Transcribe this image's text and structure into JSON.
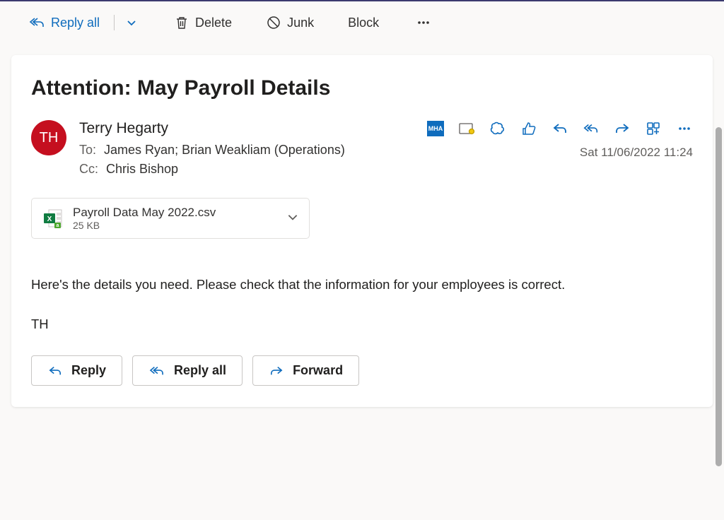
{
  "toolbar": {
    "reply_all": "Reply all",
    "delete": "Delete",
    "junk": "Junk",
    "block": "Block"
  },
  "email": {
    "subject": "Attention: May Payroll Details",
    "avatar_initials": "TH",
    "sender_name": "Terry Hegarty",
    "to_label": "To:",
    "to_recipients": "James Ryan;  Brian Weakliam (Operations)",
    "cc_label": "Cc:",
    "cc_recipients": "Chris Bishop",
    "timestamp": "Sat 11/06/2022 11:24",
    "mha_badge": "MHA"
  },
  "attachment": {
    "name": "Payroll Data May 2022.csv",
    "size": "25 KB"
  },
  "body": {
    "line1": "Here's the details you need. Please check that the information for your employees is correct.",
    "line2": "TH"
  },
  "buttons": {
    "reply": "Reply",
    "reply_all": "Reply all",
    "forward": "Forward"
  }
}
